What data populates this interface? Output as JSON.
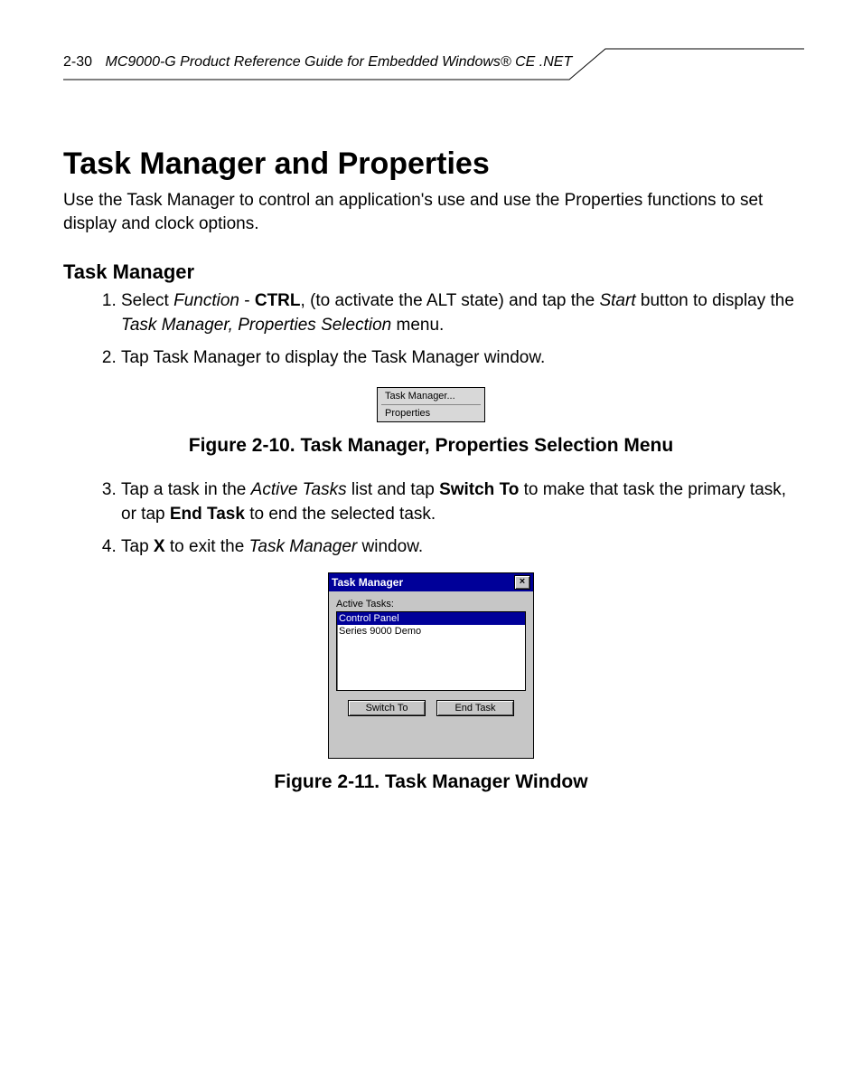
{
  "header": {
    "page_number": "2-30",
    "running_title": "MC9000-G Product Reference Guide for Embedded Windows® CE .NET"
  },
  "section": {
    "title": "Task Manager and Properties",
    "intro": "Use the Task Manager to control an application's use and use the Properties functions to set display and clock options."
  },
  "task_manager": {
    "heading": "Task Manager",
    "steps": {
      "s1": {
        "a": "Select ",
        "function": "Function",
        "dash": " - ",
        "ctrl": "CTRL",
        "b": ", (to activate the ALT state) and tap the ",
        "start": "Start",
        "c": " button to display the ",
        "menu": "Task Manager, Properties Selection",
        "d": " menu."
      },
      "s2": "Tap Task Manager to display the Task Manager window.",
      "s3": {
        "a": "Tap a task in the ",
        "active": "Active Tasks",
        "b": " list and tap ",
        "switch": "Switch To",
        "c": " to make that task the primary task, or tap ",
        "end": "End Task",
        "d": " to end the selected task."
      },
      "s4": {
        "a": "Tap ",
        "x": "X",
        "b": " to exit the ",
        "tm": "Task Manager",
        "c": " window."
      }
    }
  },
  "figure1": {
    "caption": "Figure 2-10.  Task Manager, Properties Selection Menu",
    "menu_item1": "Task Manager...",
    "menu_item2": "Properties"
  },
  "figure2": {
    "caption": "Figure 2-11.  Task Manager Window",
    "window_title": "Task Manager",
    "close": "×",
    "list_label": "Active Tasks:",
    "task1": "Control Panel",
    "task2": "Series 9000 Demo",
    "btn_switch": "Switch To",
    "btn_end": "End Task"
  }
}
